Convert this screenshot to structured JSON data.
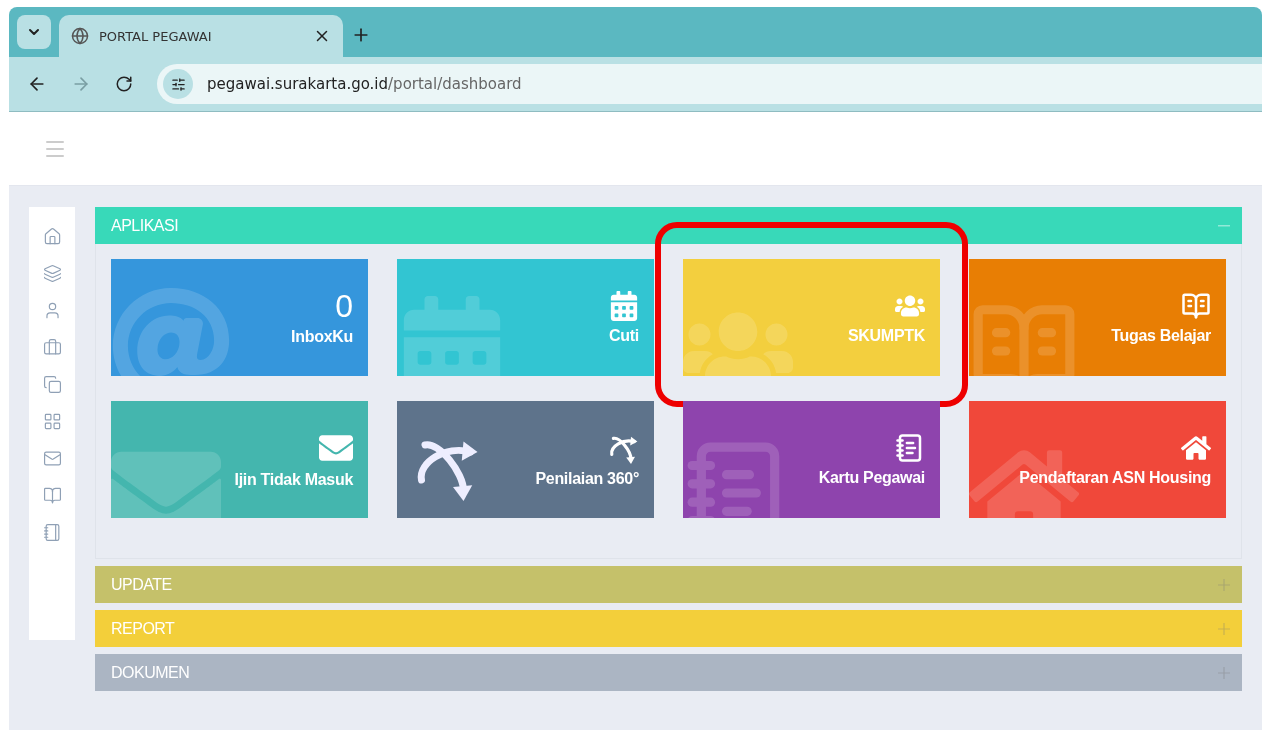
{
  "browser": {
    "tab": {
      "title": "PORTAL PEGAWAI",
      "selected": true
    },
    "url_host": "pegawai.surakarta.go.id",
    "url_path": "/portal/dashboard",
    "forward_disabled": true
  },
  "panels": [
    {
      "title": "APLIKASI",
      "expanded": true,
      "color": "#38d9b9",
      "tiles": [
        {
          "title": "InboxKu",
          "count": "0",
          "color": "#3596dc",
          "highlighted": false
        },
        {
          "title": "Cuti",
          "color": "#32c5d2",
          "highlighted": false
        },
        {
          "title": "SKUMPTK",
          "color": "#f3cf3e",
          "highlighted": true
        },
        {
          "title": "Tugas Belajar",
          "color": "#e87e04",
          "highlighted": false
        },
        {
          "title": "Ijin Tidak Masuk",
          "color": "#44b6ae",
          "highlighted": false
        },
        {
          "title": "Penilaian 360°",
          "color": "#5e738b",
          "highlighted": false
        },
        {
          "title": "Kartu Pegawai",
          "color": "#8e44ad",
          "highlighted": false
        },
        {
          "title": "Pendaftaran ASN Housing",
          "color": "#f0483a",
          "highlighted": false
        }
      ]
    },
    {
      "title": "UPDATE",
      "expanded": false,
      "color": "#c5c16a"
    },
    {
      "title": "REPORT",
      "expanded": false,
      "color": "#f3cf3a"
    },
    {
      "title": "DOKUMEN",
      "expanded": false,
      "color": "#abb5c3"
    }
  ]
}
